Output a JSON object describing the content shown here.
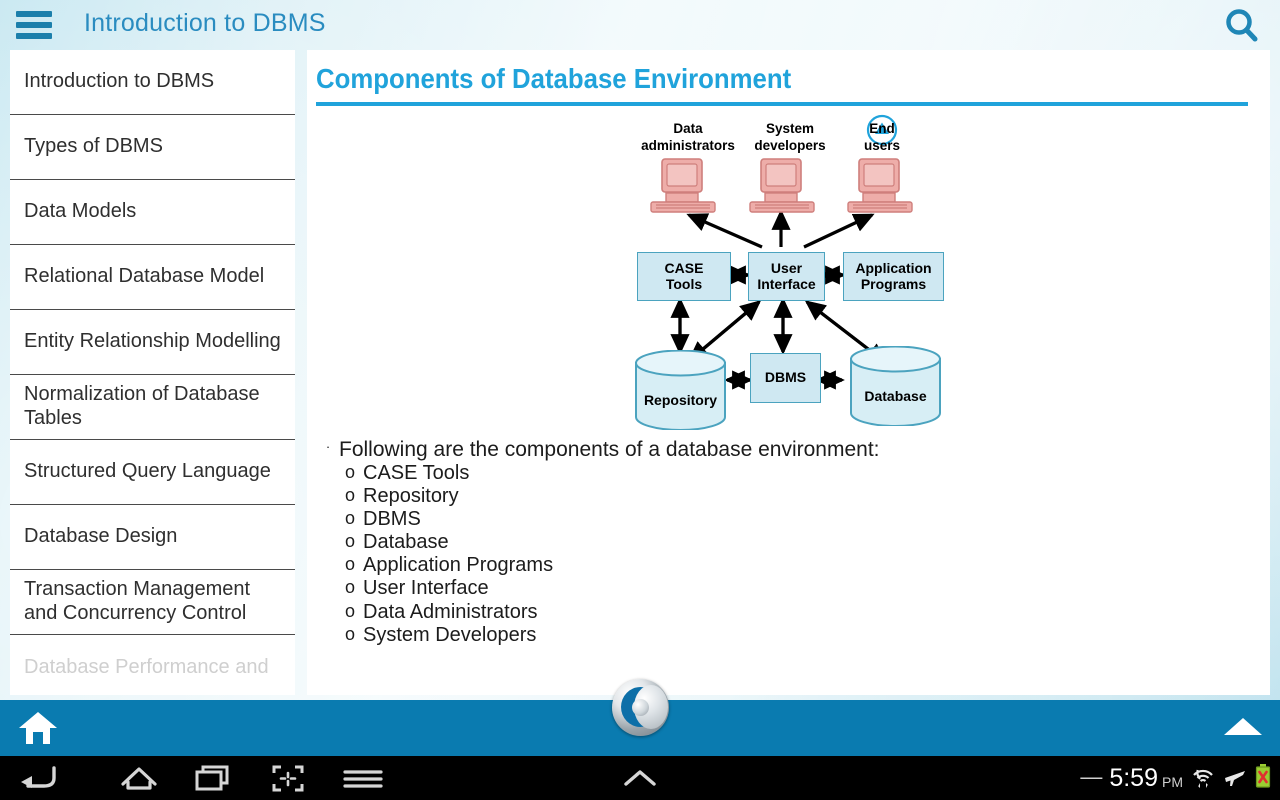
{
  "header": {
    "title": "Introduction to DBMS",
    "menu_icon": "hamburger-icon",
    "search_icon": "search-icon"
  },
  "sidebar": {
    "items": [
      {
        "label": "Introduction to DBMS",
        "faded": false
      },
      {
        "label": "Types of DBMS",
        "faded": false
      },
      {
        "label": "Data Models",
        "faded": false
      },
      {
        "label": "Relational Database Model",
        "faded": false
      },
      {
        "label": "Entity Relationship Modelling",
        "faded": false
      },
      {
        "label": "Normalization of Database Tables",
        "faded": false
      },
      {
        "label": "Structured Query Language",
        "faded": false
      },
      {
        "label": "Database Design",
        "faded": false
      },
      {
        "label": "Transaction Management and Concurrency Control",
        "faded": false
      },
      {
        "label": "Database Performance and",
        "faded": true
      }
    ]
  },
  "main": {
    "title": "Components of Database Environment",
    "collapse_icon": "circle-up-arrow-icon",
    "accent_color": "#20a3db",
    "diagram": {
      "actors": [
        {
          "label": "Data\nadministrators",
          "icon": "computer-icon"
        },
        {
          "label": "System\ndevelopers",
          "icon": "computer-icon"
        },
        {
          "label": "End\nusers",
          "icon": "computer-icon"
        }
      ],
      "boxes": [
        {
          "label": "CASE\nTools"
        },
        {
          "label": "User\nInterface"
        },
        {
          "label": "Application\nPrograms"
        },
        {
          "label": "DBMS"
        }
      ],
      "cylinders": [
        {
          "label": "Repository"
        },
        {
          "label": "Database"
        }
      ],
      "box_fill": "#cfe8f2",
      "box_border": "#4ba3bf",
      "actor_fill": "#efb3b0"
    },
    "bullets": {
      "intro": "Following are the components of a database environment:",
      "items": [
        "CASE Tools",
        "Repository",
        "DBMS",
        "Database",
        "Application Programs",
        "User Interface",
        "Data Administrators",
        "System Developers"
      ]
    }
  },
  "bottombar": {
    "home_icon": "home-icon",
    "up_arrow_icon": "up-arrow-icon",
    "logo": "app-logo-badge"
  },
  "navbar": {
    "icons": [
      "back-icon",
      "home-icon",
      "recents-icon",
      "screenshot-icon",
      "menu-icon"
    ],
    "status": {
      "dash": "—",
      "time": "5:59",
      "ampm": "PM",
      "wifi_icon": "wifi-icon",
      "airplane_icon": "airplane-mode-icon",
      "battery_icon": "battery-error-icon"
    }
  }
}
